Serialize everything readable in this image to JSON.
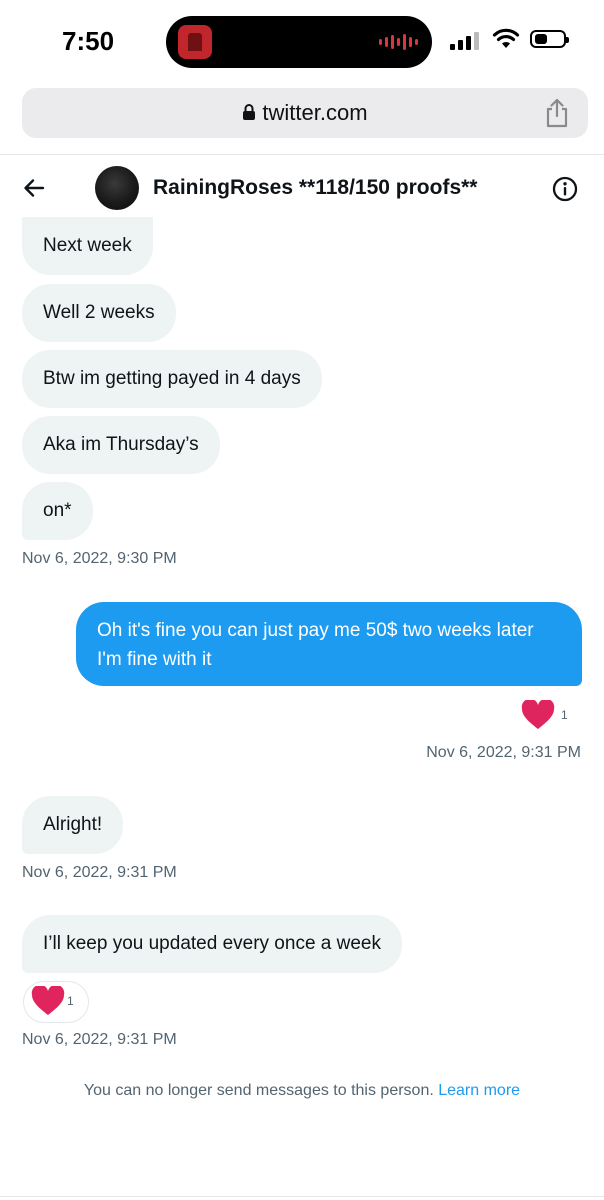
{
  "status_bar": {
    "time": "7:50"
  },
  "browser": {
    "url": "twitter.com"
  },
  "chat": {
    "title": "RainingRoses **118/150 proofs**"
  },
  "messages": [
    {
      "text": "Next week"
    },
    {
      "text": "Well 2 weeks"
    },
    {
      "text": "Btw im getting payed in 4 days"
    },
    {
      "text": "Aka im Thursday’s"
    },
    {
      "text": "on*"
    },
    {
      "text": "Oh it's fine you can just pay me 50$ two weeks later I'm fine with it"
    },
    {
      "text": "Alright!"
    },
    {
      "text": "I’ll keep you updated every once a week"
    }
  ],
  "timestamps": [
    "Nov 6, 2022, 9:30 PM",
    "Nov 6, 2022, 9:31 PM",
    "Nov 6, 2022, 9:31 PM",
    "Nov 6, 2022, 9:31 PM"
  ],
  "reactions": [
    {
      "emoji": "heart",
      "count": "1"
    },
    {
      "emoji": "heart",
      "count": "1"
    }
  ],
  "footer": {
    "notice": "You can no longer send messages to this person.",
    "link": "Learn more"
  },
  "colors": {
    "accent": "#1d9bf0",
    "incoming_bubble": "#eef3f4",
    "heart": "#e0245e",
    "secondary_text": "#536471"
  }
}
